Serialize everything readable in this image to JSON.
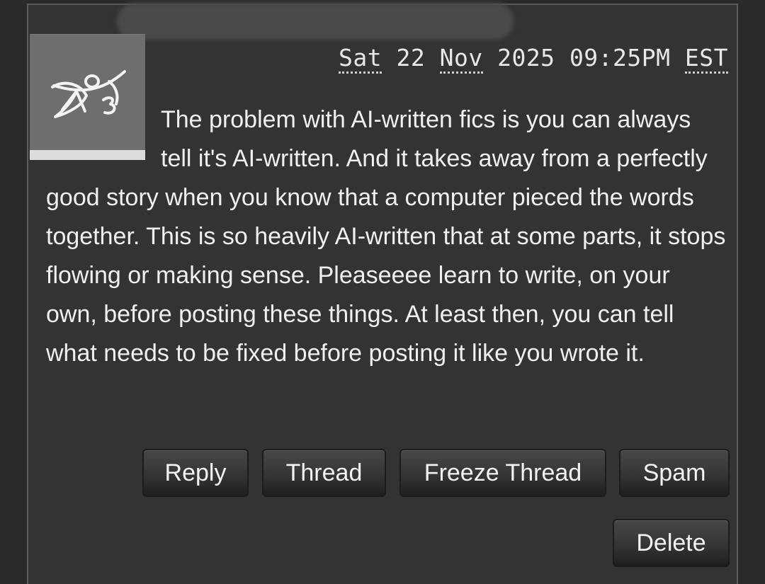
{
  "comment": {
    "date": {
      "weekday": "Sat",
      "day": "22",
      "month": "Nov",
      "year": "2025",
      "time": "09:25PM",
      "timezone": "EST"
    },
    "avatar_icon": "ao3-logo-icon",
    "body": "The problem with AI-written fics is you can always tell it's AI-written. And it takes away from a perfectly good story when you know that a computer pieced the words together. This is so heavily AI-written that at some parts, it stops flowing or making sense. Pleaseeee learn to write, on your own, before posting these things. At least then, you can tell what needs to be fixed before posting it like you wrote it."
  },
  "actions": {
    "reply": "Reply",
    "thread": "Thread",
    "freeze_thread": "Freeze Thread",
    "spam": "Spam",
    "delete": "Delete"
  },
  "colors": {
    "background": "#2a2a2a",
    "panel": "#333333",
    "text": "#f0f0f0",
    "avatar_bg": "#6e6e6e"
  }
}
